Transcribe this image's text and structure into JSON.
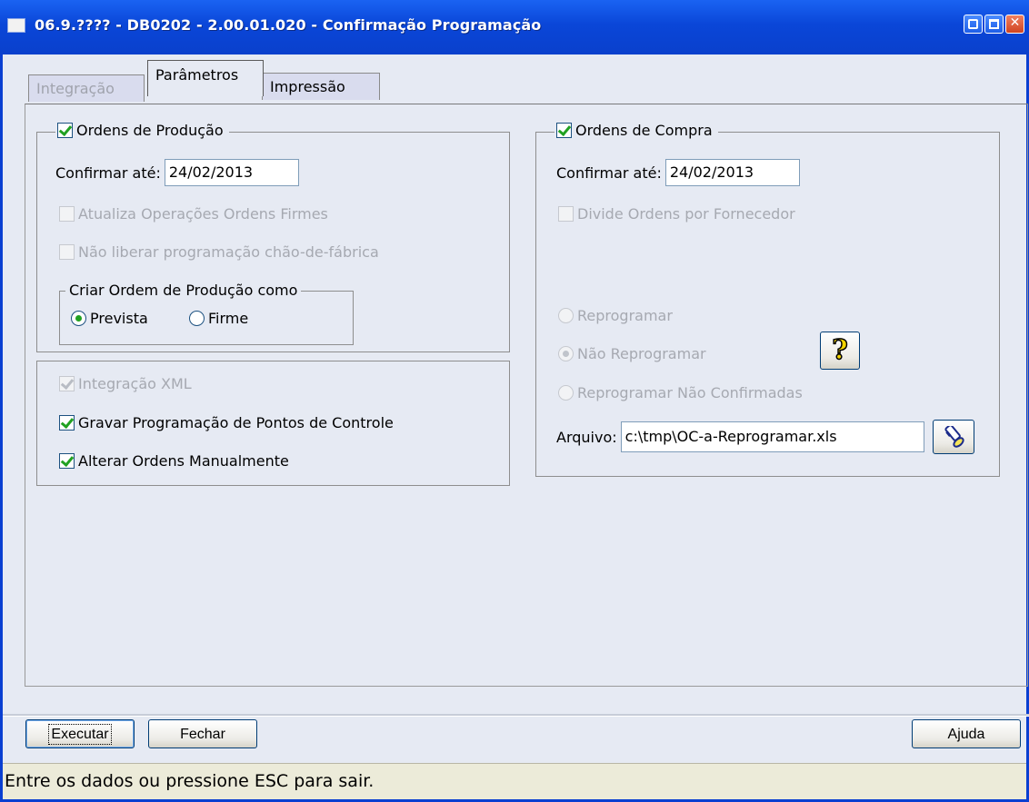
{
  "window": {
    "title": "06.9.???? - DB0202 - 2.00.01.020 - Confirmação Programação",
    "close_glyph": "✕"
  },
  "tabs": [
    {
      "label": "Integração",
      "state": "disabled"
    },
    {
      "label": "Parâmetros",
      "state": "active"
    },
    {
      "label": "Impressão",
      "state": "normal"
    }
  ],
  "producao": {
    "legend": "Ordens de Produção",
    "checked": true,
    "confirmar_label": "Confirmar até:",
    "confirmar_value": "24/02/2013",
    "atualiza_label": "Atualiza Operações Ordens Firmes",
    "nao_liberar_label": "Não liberar programação chão-de-fábrica",
    "criar_group": {
      "legend": "Criar Ordem de Produção como",
      "options": [
        "Prevista",
        "Firme"
      ],
      "selected": "Prevista"
    }
  },
  "extras": {
    "integracao_xml_label": "Integração XML",
    "gravar_label": "Gravar Programação de Pontos de Controle",
    "alterar_label": "Alterar Ordens Manualmente"
  },
  "compra": {
    "legend": "Ordens de Compra",
    "checked": true,
    "confirmar_label": "Confirmar até:",
    "confirmar_value": "24/02/2013",
    "divide_label": "Divide Ordens por Fornecedor",
    "reprog_options": [
      "Reprogramar",
      "Não Reprogramar",
      "Reprogramar Não Confirmadas"
    ],
    "reprog_selected": "Não Reprogramar",
    "help_glyph": "?",
    "arquivo_label": "Arquivo:",
    "arquivo_value": "c:\\tmp\\OC-a-Reprogramar.xls"
  },
  "buttons": {
    "executar": "Executar",
    "fechar": "Fechar",
    "ajuda": "Ajuda"
  },
  "status": "Entre os dados ou pressione ESC para sair.",
  "colors": {
    "titlebar": "#0a46d8",
    "window_bg": "#e6eaf3",
    "check_green": "#21a121",
    "status_bg": "#ecebd9"
  }
}
